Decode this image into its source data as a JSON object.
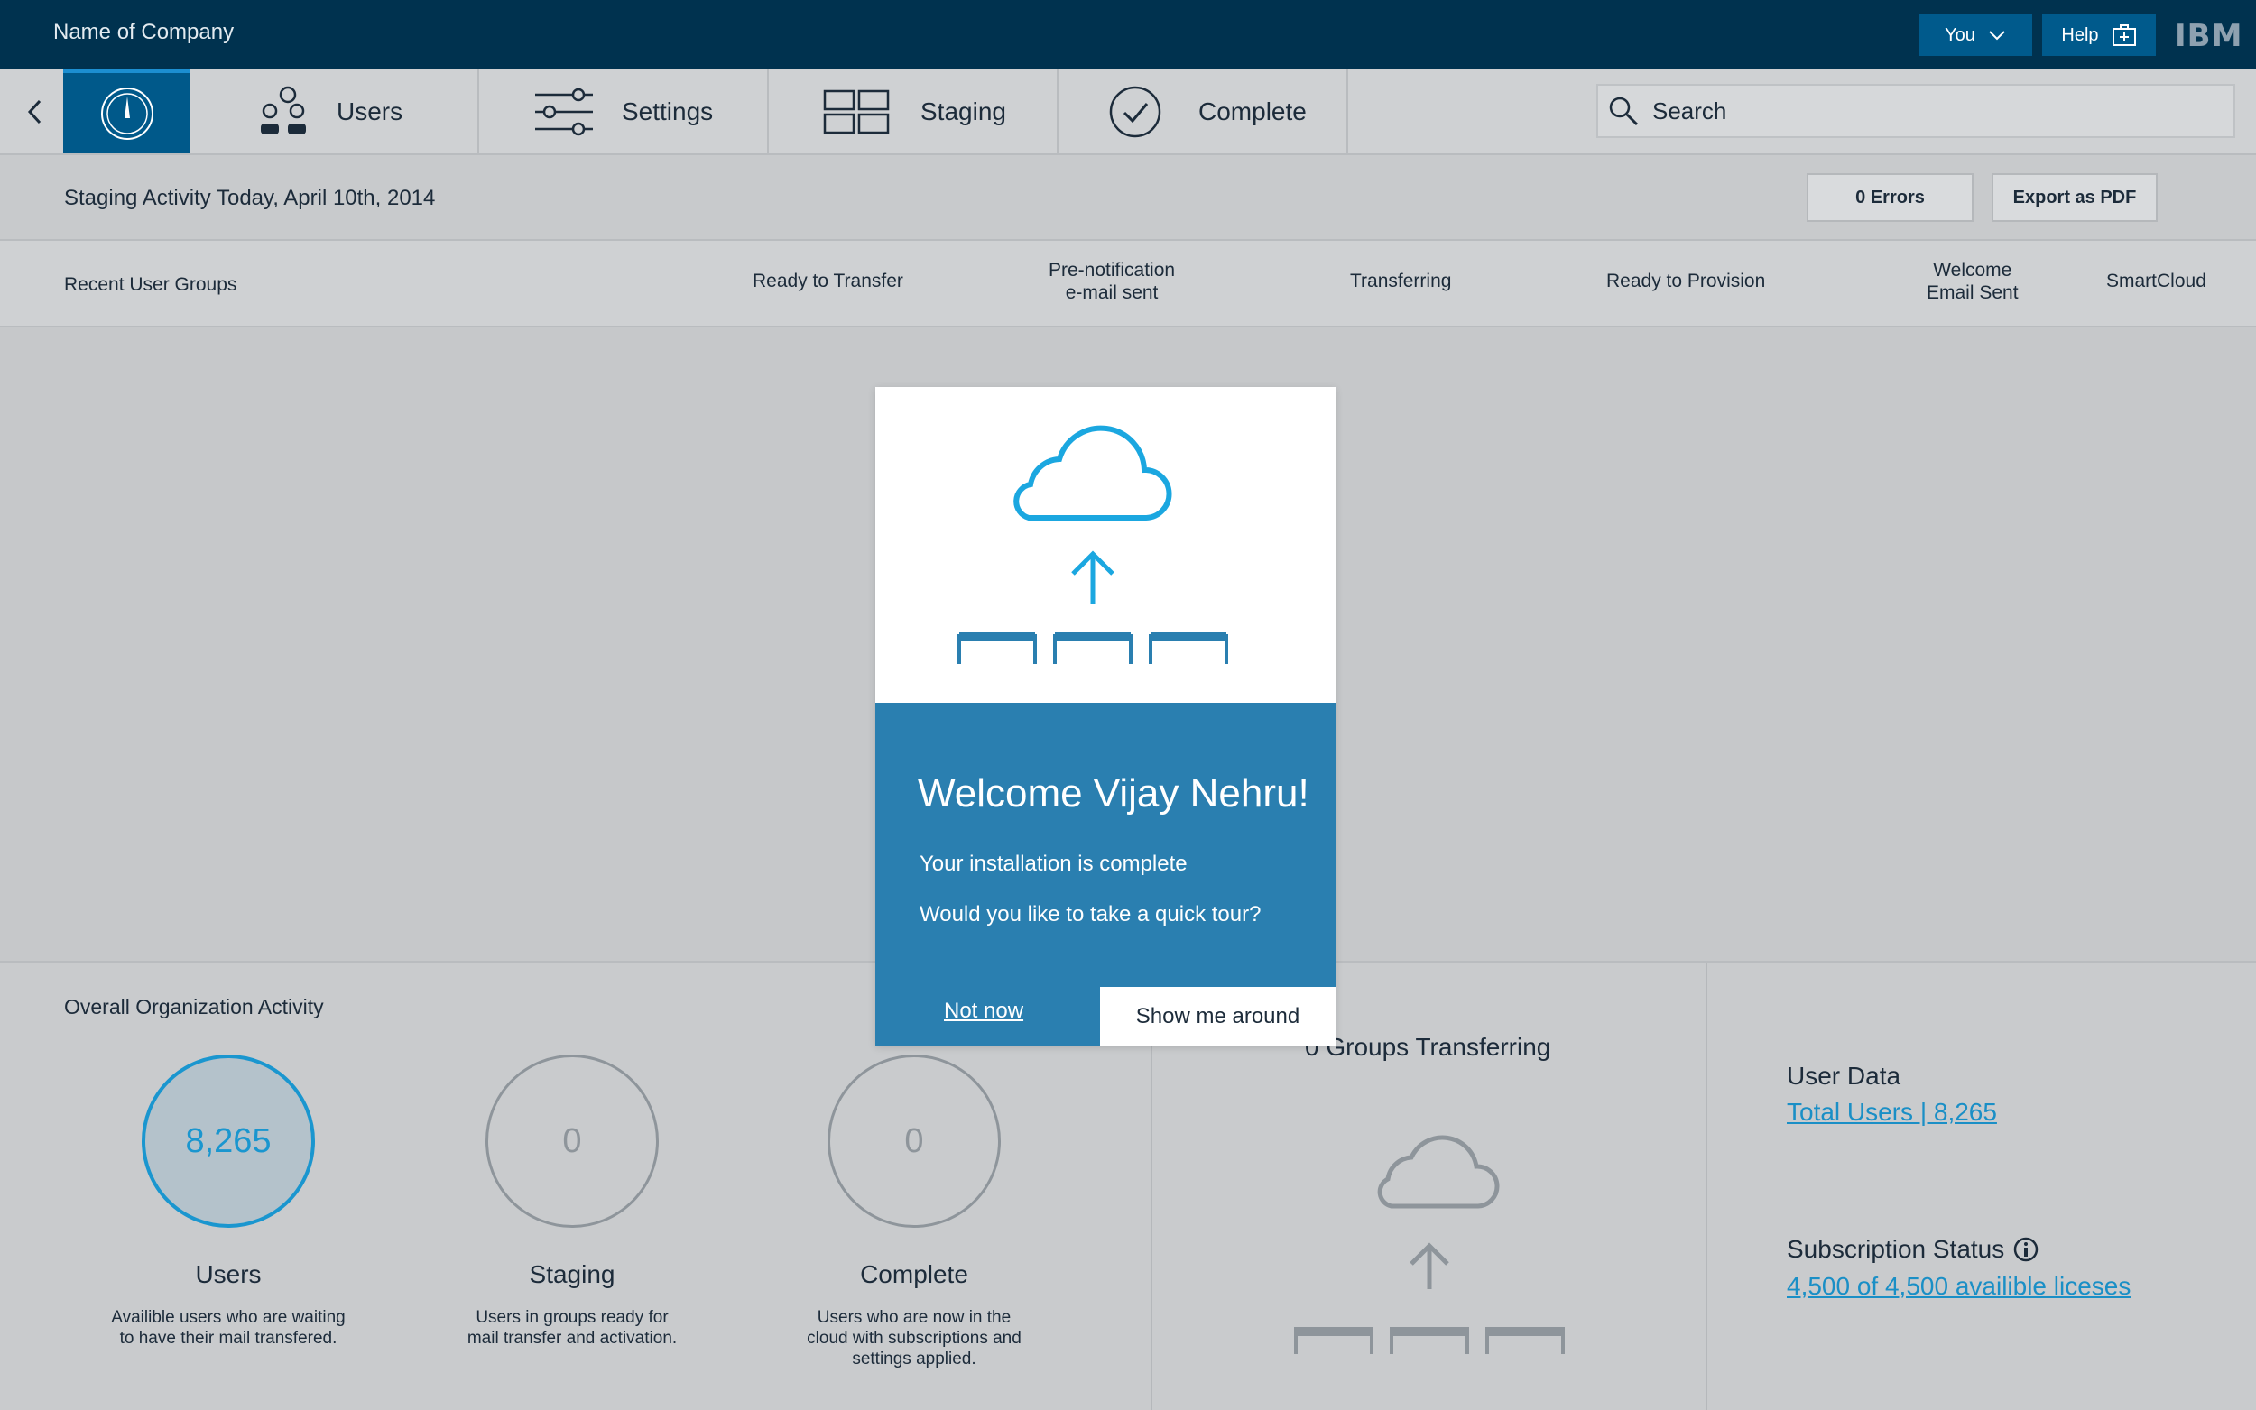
{
  "header": {
    "company": "Name of Company",
    "you_label": "You",
    "help_label": "Help",
    "logo": "IBM"
  },
  "nav": {
    "tabs": [
      {
        "label": "Users",
        "icon": "users-icon"
      },
      {
        "label": "Settings",
        "icon": "sliders-icon"
      },
      {
        "label": "Staging",
        "icon": "grid-icon"
      },
      {
        "label": "Complete",
        "icon": "checkmark-circle-icon"
      }
    ],
    "search_placeholder": "Search"
  },
  "activity": {
    "title": "Staging Activity Today, April 10th, 2014",
    "errors_button": "0 Errors",
    "export_button": "Export as PDF"
  },
  "columns": {
    "recent": "Recent User Groups",
    "ready_transfer": "Ready to Transfer",
    "prenotification_1": "Pre-notification",
    "prenotification_2": "e-mail sent",
    "transferring": "Transferring",
    "ready_provision": "Ready to Provision",
    "welcome_1": "Welcome",
    "welcome_2": "Email Sent",
    "smartcloud": "SmartCloud"
  },
  "overall": {
    "title": "Overall Organization Activity",
    "stats": [
      {
        "value": "8,265",
        "label": "Users",
        "desc_1": "Availible users who are waiting",
        "desc_2": "to have their mail transfered.",
        "desc_3": ""
      },
      {
        "value": "0",
        "label": "Staging",
        "desc_1": "Users in groups ready for",
        "desc_2": "mail transfer and activation.",
        "desc_3": ""
      },
      {
        "value": "0",
        "label": "Complete",
        "desc_1": "Users who are now in the",
        "desc_2": "cloud with subscriptions and",
        "desc_3": "settings applied."
      }
    ]
  },
  "groups": {
    "title": "0 Groups Transferring"
  },
  "user_data": {
    "label": "User Data",
    "link": "Total Users | 8,265",
    "subscription_label": "Subscription Status",
    "subscription_link": "4,500 of 4,500 availible liceses"
  },
  "modal": {
    "heading": "Welcome Vijay Nehru!",
    "line1": "Your installation is complete",
    "line2": "Would you like to take a quick tour?",
    "not_now": "Not now",
    "show_me": "Show me around"
  },
  "colors": {
    "topbar": "#00324f",
    "accent": "#1a96cf",
    "modal_blue": "#2a7fb0",
    "button_blue": "#005a8c"
  }
}
